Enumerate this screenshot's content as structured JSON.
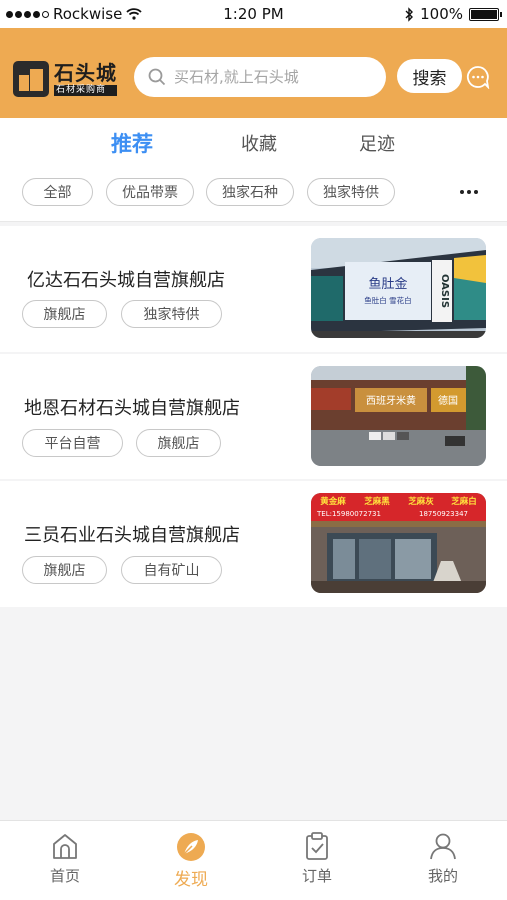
{
  "status_bar": {
    "carrier": "Rockwise",
    "time": "1:20 PM",
    "battery": "100%"
  },
  "header": {
    "logo_title": "石头城",
    "logo_subtitle": "石材采购商",
    "search_placeholder": "买石材,就上石头城",
    "search_value": "",
    "search_button": "搜索",
    "accent_color": "#eeaa52"
  },
  "tabs": [
    {
      "label": "推荐",
      "active": true
    },
    {
      "label": "收藏",
      "active": false
    },
    {
      "label": "足迹",
      "active": false
    }
  ],
  "filters": [
    "全部",
    "优品带票",
    "独家石种",
    "独家特供"
  ],
  "stores": [
    {
      "name": "亿达石石头城自营旗舰店",
      "tags": [
        "旗舰店",
        "独家特供"
      ]
    },
    {
      "name": "地恩石材石头城自营旗舰店",
      "tags": [
        "平台自营",
        "旗舰店"
      ]
    },
    {
      "name": "三员石业石头城自营旗舰店",
      "tags": [
        "旗舰店",
        "自有矿山"
      ]
    }
  ],
  "thumb_signs": {
    "store1_sign": "鱼肚金",
    "store1_sign_sub": "鱼肚白 雪花白",
    "store1_brand": "OASIS",
    "store2_sign": "西班牙米黄",
    "store2_sign_right": "德国",
    "store3_signs": [
      "黄金麻",
      "芝麻黑",
      "芝麻灰",
      "芝麻白"
    ],
    "store3_phone1": "TEL:15980072731",
    "store3_phone2": "18750923347"
  },
  "tab_bar": [
    {
      "label": "首页",
      "icon": "home-icon",
      "active": false
    },
    {
      "label": "发现",
      "icon": "compass-icon",
      "active": true
    },
    {
      "label": "订单",
      "icon": "clipboard-icon",
      "active": false
    },
    {
      "label": "我的",
      "icon": "user-icon",
      "active": false
    }
  ]
}
